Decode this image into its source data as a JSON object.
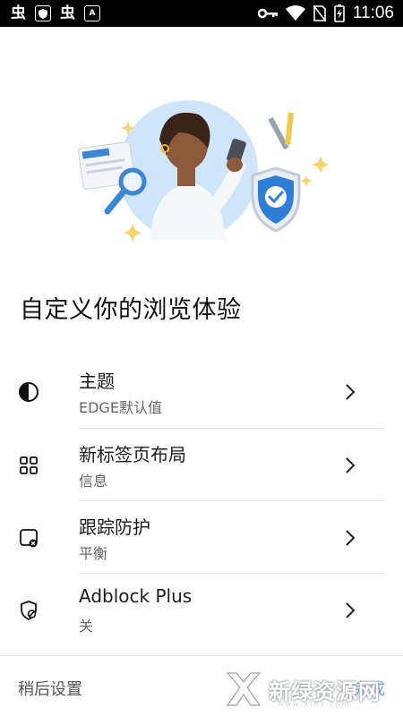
{
  "status_bar": {
    "time": "11:06",
    "left_icons": [
      "app-glyph-icon",
      "shield-small-icon",
      "app-glyph-icon",
      "font-a-icon"
    ],
    "right_icons": [
      "key-icon",
      "wifi-icon",
      "no-sim-icon",
      "battery-charging-icon"
    ]
  },
  "page": {
    "title": "自定义你的浏览体验"
  },
  "options": [
    {
      "title": "主题",
      "value": "EDGE默认值",
      "icon": "contrast-icon"
    },
    {
      "title": "新标签页布局",
      "value": "信息",
      "icon": "grid-icon"
    },
    {
      "title": "跟踪防护",
      "value": "平衡",
      "icon": "tracking-icon"
    },
    {
      "title": "Adblock Plus",
      "value": "关",
      "icon": "shield-block-icon"
    }
  ],
  "footer": {
    "later": "稍后设置",
    "done": "完成"
  },
  "watermark": {
    "text": "新绿资源网",
    "url": "www.xlhs.com"
  },
  "colors": {
    "accent": "#1a73e8",
    "hero_circle": "#cfe6fa",
    "shield": "#2f7fd6"
  }
}
